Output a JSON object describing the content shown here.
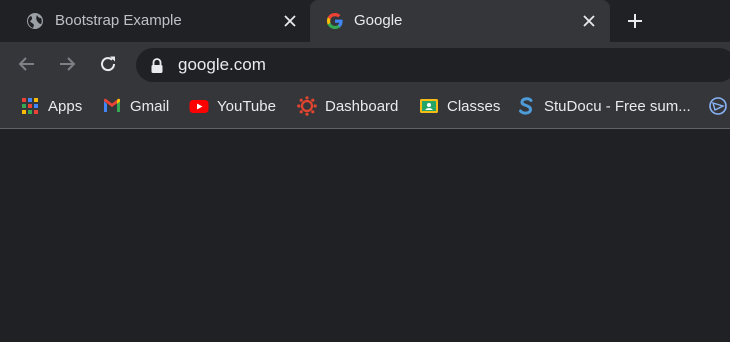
{
  "tabs": [
    {
      "title": "Bootstrap Example",
      "active": false,
      "favicon": "globe-icon"
    },
    {
      "title": "Google",
      "active": true,
      "favicon": "google-g-icon"
    }
  ],
  "toolbar": {
    "url": "google.com"
  },
  "bookmarks": [
    {
      "label": "Apps",
      "icon": "apps-grid-icon"
    },
    {
      "label": "Gmail",
      "icon": "gmail-icon"
    },
    {
      "label": "YouTube",
      "icon": "youtube-icon"
    },
    {
      "label": "Dashboard",
      "icon": "canvas-icon"
    },
    {
      "label": "Classes",
      "icon": "google-classroom-icon"
    },
    {
      "label": "StuDocu - Free sum...",
      "icon": "studocu-icon"
    }
  ],
  "colors": {
    "background": "#202124",
    "toolbar": "#35363a",
    "text": "#e8eaed"
  }
}
